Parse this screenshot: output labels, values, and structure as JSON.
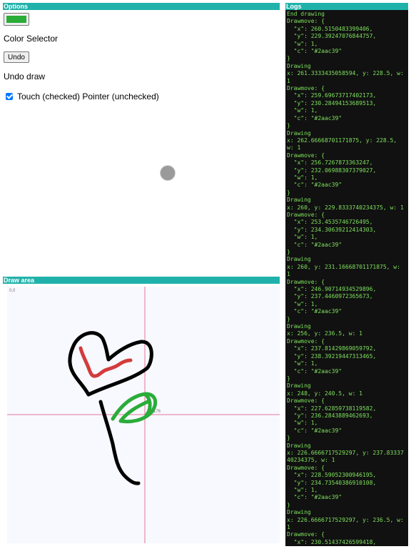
{
  "options": {
    "header": "Options",
    "color_value": "#2aac39",
    "color_label": "Color Selector",
    "undo_button": "Undo",
    "undo_label": "Undo draw",
    "touch_label": "Touch (checked) Pointer (unchecked)",
    "touch_checked": true
  },
  "draw": {
    "header": "Draw area",
    "origin_label": "0,0",
    "crosshair_label": "176"
  },
  "logs": {
    "header": "Logs",
    "text": "End drawing\nDrawmove: {\n  \"x\": 260.5150483399406,\n  \"y\": 229.39247076844757,\n  \"w\": 1,\n  \"c\": \"#2aac39\"\n}\nDrawing\nx: 261.3333435058594, y: 228.5, w: 1\nDrawmove: {\n  \"x\": 259.69673717402173,\n  \"y\": 230.28494153689513,\n  \"w\": 1,\n  \"c\": \"#2aac39\"\n}\nDrawing\nx: 262.66668701171875, y: 228.5, w: 1\nDrawmove: {\n  \"x\": 256.7267873363247,\n  \"y\": 232.06988307379027,\n  \"w\": 1,\n  \"c\": \"#2aac39\"\n}\nDrawing\nx: 260, y: 229.8333740234375, w: 1\nDrawmove: {\n  \"x\": 253.4535746726495,\n  \"y\": 234.30639212414303,\n  \"w\": 1,\n  \"c\": \"#2aac39\"\n}\nDrawing\nx: 260, y: 231.16668701171875, w: 1\nDrawmove: {\n  \"x\": 246.90714934529896,\n  \"y\": 237.4460972365673,\n  \"w\": 1,\n  \"c\": \"#2aac39\"\n}\nDrawing\nx: 256, y: 236.5, w: 1\nDrawmove: {\n  \"x\": 237.81429869059792,\n  \"y\": 238.39219447313465,\n  \"w\": 1,\n  \"c\": \"#2aac39\"\n}\nDrawing\nx: 248, y: 240.5, w: 1\nDrawmove: {\n  \"x\": 227.62859738119582,\n  \"y\": 236.2843889462693,\n  \"w\": 1,\n  \"c\": \"#2aac39\"\n}\nDrawing\nx: 226.6666717529297, y: 237.8333740234375, w: 1\nDrawmove: {\n  \"x\": 228.59052300946195,\n  \"y\": 234.73540386910108,\n  \"w\": 1,\n  \"c\": \"#2aac39\"\n}\nDrawing\nx: 226.6666717529297, y: 236.5, w: 1\nDrawmove: {\n  \"x\": 230.51437426599418,"
  },
  "colors": {
    "accent": "#20b2aa",
    "stroke_black": "#000000",
    "stroke_red": "#d23c3c",
    "stroke_green": "#2aac39",
    "crosshair": "#e0507a",
    "log_text": "#7ee05d"
  }
}
